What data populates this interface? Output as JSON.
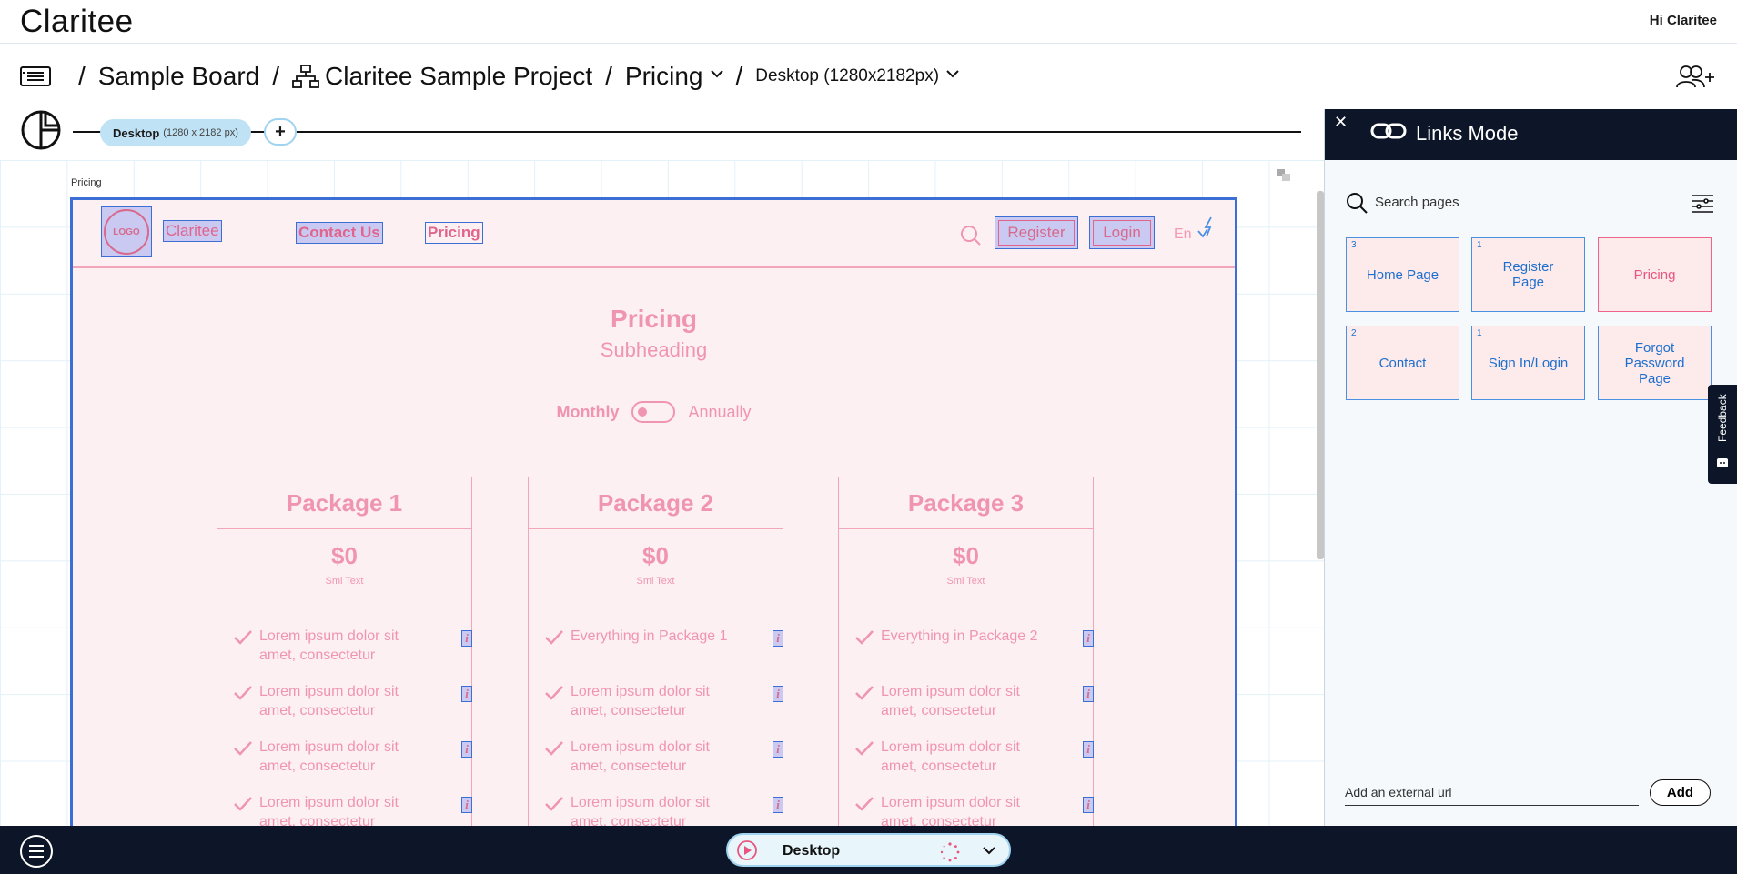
{
  "app": {
    "brand": "Claritee",
    "greeting": "Hi Claritee"
  },
  "breadcrumb": {
    "board": "Sample Board",
    "project": "Claritee Sample Project",
    "page": "Pricing",
    "device": "Desktop (1280x2182px)"
  },
  "versions": {
    "chip_label": "Desktop",
    "chip_size": "(1280 x 2182 px)",
    "add_label": "+"
  },
  "canvas": {
    "frame_label": "Pricing"
  },
  "mock": {
    "logo": "LOGO",
    "brand": "Claritee",
    "nav": [
      "Contact Us",
      "Pricing"
    ],
    "register": "Register",
    "login": "Login",
    "lang": "En",
    "title": "Pricing",
    "subheading": "Subheading",
    "monthly": "Monthly",
    "annually": "Annually",
    "packages": [
      {
        "name": "Package 1",
        "price": "$0",
        "sub": "Sml Text",
        "features": [
          "Lorem ipsum dolor sit amet, consectetur",
          "Lorem ipsum dolor sit amet, consectetur",
          "Lorem ipsum dolor sit amet, consectetur",
          "Lorem ipsum dolor sit amet, consectetur"
        ]
      },
      {
        "name": "Package 2",
        "price": "$0",
        "sub": "Sml Text",
        "features": [
          "Everything in Package 1",
          "Lorem ipsum dolor sit amet, consectetur",
          "Lorem ipsum dolor sit amet, consectetur",
          "Lorem ipsum dolor sit amet, consectetur"
        ]
      },
      {
        "name": "Package 3",
        "price": "$0",
        "sub": "Sml Text",
        "features": [
          "Everything in Package 2",
          "Lorem ipsum dolor sit amet, consectetur",
          "Lorem ipsum dolor sit amet, consectetur",
          "Lorem ipsum dolor sit amet, consectetur"
        ]
      }
    ],
    "info_glyph": "i"
  },
  "links_panel": {
    "close": "✕",
    "title": "Links Mode",
    "search_placeholder": "Search pages",
    "pages": [
      {
        "name": "Home Page",
        "count": "3"
      },
      {
        "name": "Register Page",
        "count": "1"
      },
      {
        "name": "Pricing",
        "count": ""
      },
      {
        "name": "Contact",
        "count": "2"
      },
      {
        "name": "Sign In/Login",
        "count": "1"
      },
      {
        "name": "Forgot Password Page",
        "count": ""
      }
    ],
    "url_placeholder": "Add an external url",
    "add_label": "Add",
    "feedback": "Feedback"
  },
  "bottombar": {
    "device": "Desktop"
  },
  "colors": {
    "accent": "#3b6fd6",
    "mock_pink": "#f095b1",
    "dark": "#0c1628",
    "chip": "#bfe2f5"
  }
}
